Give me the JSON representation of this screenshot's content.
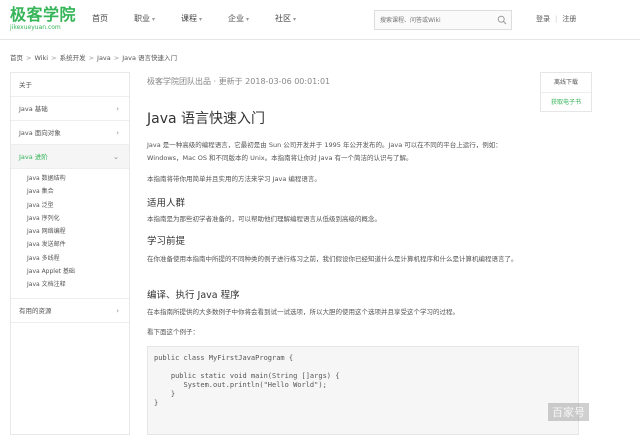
{
  "logo": {
    "main": "极客学院",
    "sub": "jikexueyuan.com"
  },
  "nav": [
    {
      "label": "首页",
      "has_caret": false
    },
    {
      "label": "职业",
      "has_caret": true
    },
    {
      "label": "课程",
      "has_caret": true
    },
    {
      "label": "企业",
      "has_caret": true
    },
    {
      "label": "社区",
      "has_caret": true
    }
  ],
  "search": {
    "placeholder": "搜索课程、问答或Wiki"
  },
  "auth": {
    "login": "登录",
    "register": "注册",
    "separator": "|"
  },
  "breadcrumb": [
    "首页",
    "Wiki",
    "系统开发",
    "Java",
    "Java 语言快速入门"
  ],
  "sidebar": {
    "top_items": [
      {
        "label": "关于"
      },
      {
        "label": "Java 基础"
      },
      {
        "label": "Java 面向对象"
      }
    ],
    "active": {
      "label": "Java 进阶"
    },
    "sub_items": [
      "Java 数据结构",
      "Java 集合",
      "Java 泛型",
      "Java 序列化",
      "Java 网络编程",
      "Java 发送邮件",
      "Java 多线程",
      "Java Applet 基础",
      "Java 文档注释"
    ],
    "bottom_item": {
      "label": "有用的资源"
    }
  },
  "meta": "极客学院团队出品 · 更新于 2018-03-06 00:01:01",
  "title": "Java 语言快速入门",
  "intro": "Java 是一种高级的编程语言，它最初是由 Sun 公司开发并于 1995 年公开发布的。Java 可以在不同的平台上运行，例如：Windows，Mac OS 和不同版本的 Unix。本指南将让你对 Java 有一个简洁的认识与了解。",
  "intro2": "本指南将带你用简单并且实用的方法来学习 Java 编程语言。",
  "audience": {
    "heading": "适用人群",
    "text": "本指南是为那些初学者准备的，可以帮助他们理解编程语言从低级到高级的概念。"
  },
  "prereq": {
    "heading": "学习前提",
    "text": "在你准备使用本指南中所提的不同种类的例子进行练习之前，我们假设你已经知道什么是计算机程序和什么是计算机编程语言了。"
  },
  "compile": {
    "heading": "编译、执行 Java 程序",
    "text": "在本指南所提供的大多数例子中你将会看到试一试选项，所以大胆的使用这个选项并且享受这个学习的过程。",
    "example_intro": "看下面这个例子："
  },
  "code_lines": [
    "public class MyFirstJavaProgram {",
    "",
    "    public static void main(String []args) {",
    "       System.out.println(\"Hello World\");",
    "    }",
    "}"
  ],
  "right_panel": {
    "download": "离线下载",
    "ebook": "获取电子书"
  },
  "watermark": "百家号",
  "colors": {
    "brand": "#35b558",
    "text": "#333333",
    "muted": "#888888",
    "border": "#e6e6e6"
  }
}
